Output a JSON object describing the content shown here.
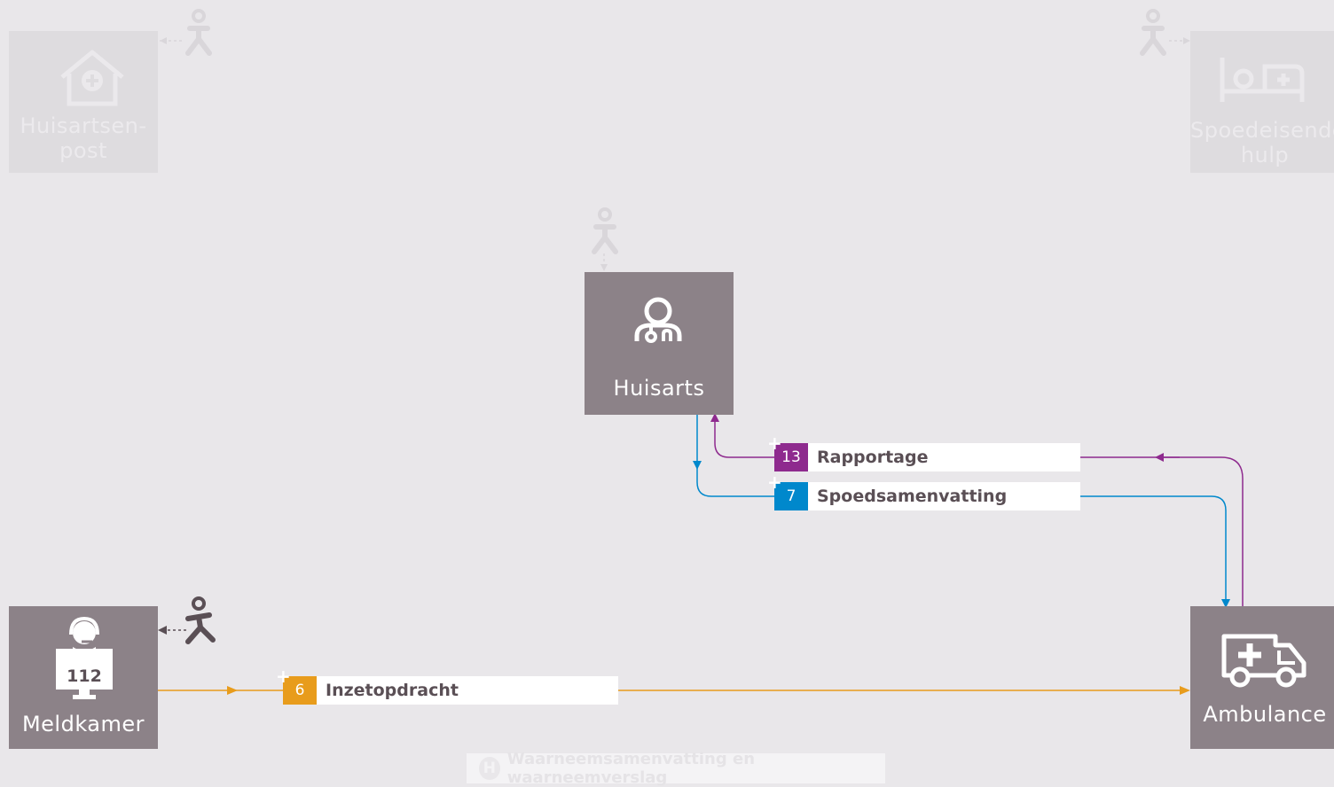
{
  "nodes": {
    "huisartsenpost": {
      "label_line1": "Huisartsen-",
      "label_line2": "post",
      "icon": "house-plus-icon"
    },
    "spoedeisende_hulp": {
      "label_line1": "Spoedeisende",
      "label_line2": "hulp",
      "icon": "hospital-bed-icon"
    },
    "huisarts": {
      "label": "Huisarts",
      "icon": "doctor-icon"
    },
    "meldkamer": {
      "label": "Meldkamer",
      "screen_text": "112",
      "icon": "operator-headset-icon"
    },
    "ambulance": {
      "label": "Ambulance",
      "icon": "ambulance-icon"
    }
  },
  "messages": [
    {
      "number": "13",
      "label": "Rapportage",
      "color": "#8e2a8e"
    },
    {
      "number": "7",
      "label": "Spoedsamenvatting",
      "color": "#0088cc"
    },
    {
      "number": "6",
      "label": "Inzetopdracht",
      "color": "#e89c1c"
    }
  ],
  "footer": {
    "badge_letter": "H",
    "label": "Waarneemsamenvatting en waarneemverslag"
  },
  "colors": {
    "node": "#8c8288",
    "node_faded": "#dedcdf",
    "background": "#e9e7ea",
    "purple": "#8e2a8e",
    "blue": "#0088cc",
    "orange": "#e89c1c",
    "patient_active": "#5a4f55",
    "patient_faded": "#d9d6da"
  }
}
